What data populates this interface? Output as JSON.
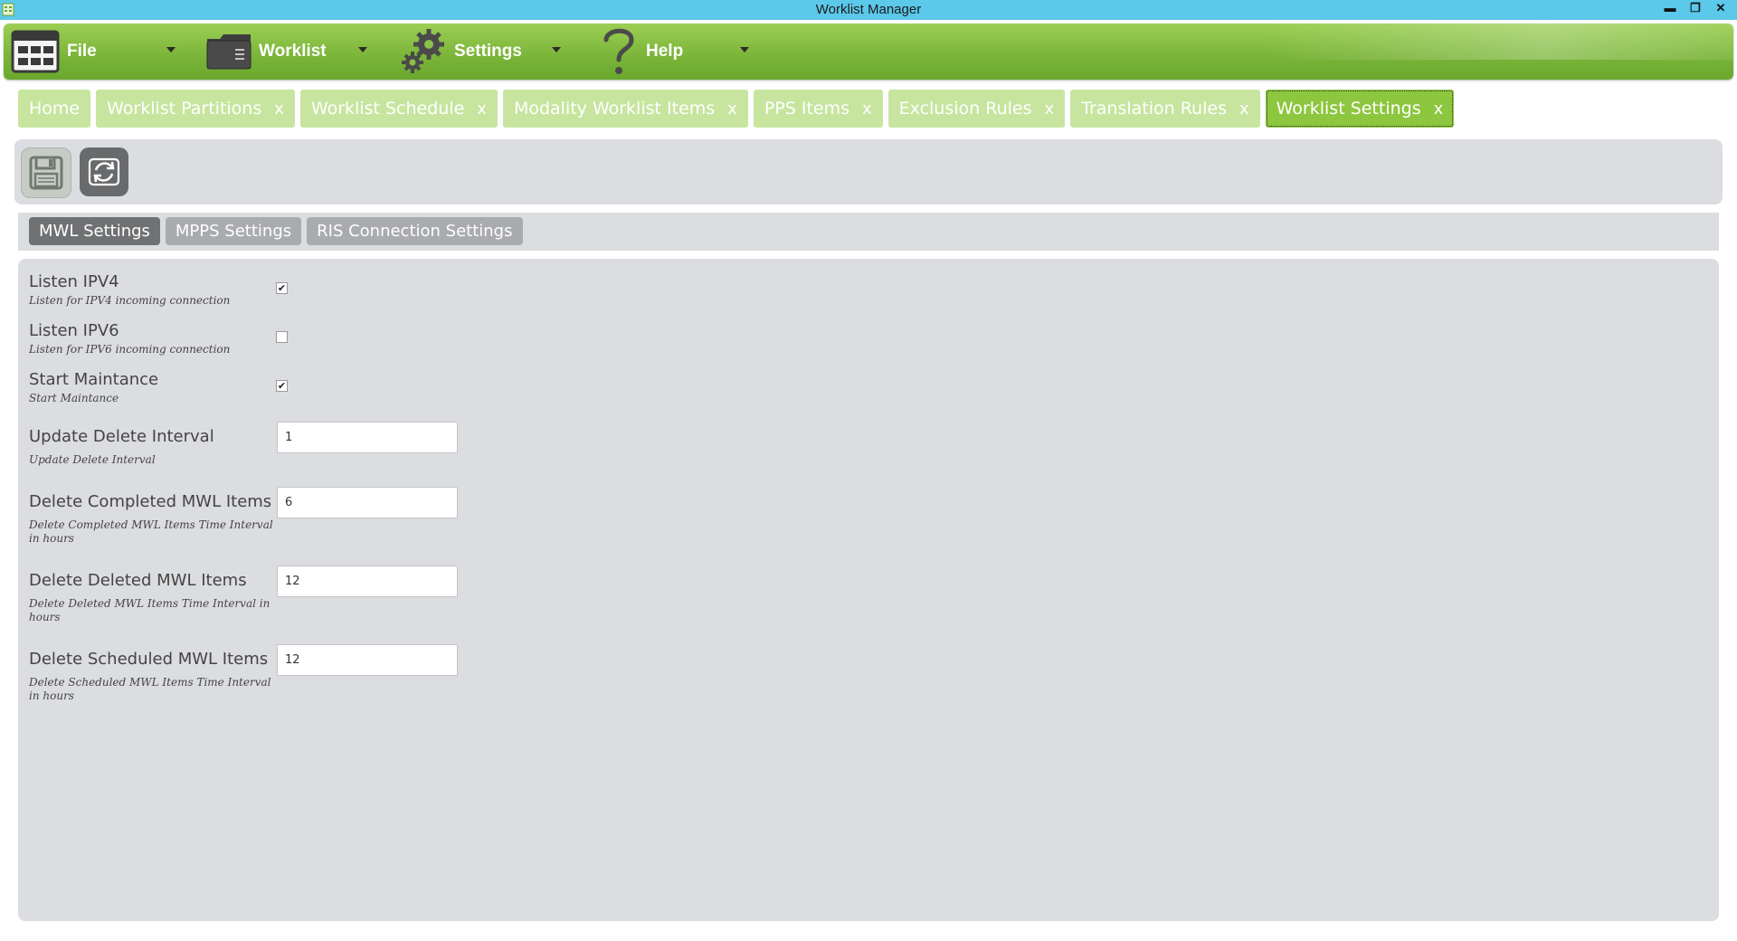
{
  "window": {
    "title": "Worklist Manager",
    "controls": {
      "minimize": "▬",
      "restore": "❐",
      "close": "✕"
    }
  },
  "menu": [
    {
      "label": "File",
      "icon": "file-grid-icon"
    },
    {
      "label": "Worklist",
      "icon": "worklist-folder-icon"
    },
    {
      "label": "Settings",
      "icon": "settings-gears-icon"
    },
    {
      "label": "Help",
      "icon": "help-question-icon"
    }
  ],
  "tabs": [
    {
      "label": "Home",
      "closable": false
    },
    {
      "label": "Worklist Partitions",
      "closable": true
    },
    {
      "label": "Worklist Schedule",
      "closable": true
    },
    {
      "label": "Modality Worklist Items",
      "closable": true
    },
    {
      "label": "PPS Items",
      "closable": true
    },
    {
      "label": "Exclusion Rules",
      "closable": true
    },
    {
      "label": "Translation Rules",
      "closable": true
    },
    {
      "label": "Worklist Settings",
      "closable": true,
      "active": true
    }
  ],
  "tab_close_label": "x",
  "toolbar": {
    "save_icon": "save-icon",
    "refresh_icon": "refresh-icon"
  },
  "subtabs": [
    {
      "label": "MWL Settings",
      "active": true
    },
    {
      "label": "MPPS Settings"
    },
    {
      "label": "RIS Connection Settings"
    }
  ],
  "settings": {
    "listen_ipv4": {
      "label": "Listen IPV4",
      "desc": "Listen for IPV4 incoming connection",
      "checked": true
    },
    "listen_ipv6": {
      "label": "Listen IPV6",
      "desc": "Listen for IPV6 incoming connection",
      "checked": false
    },
    "start_maintance": {
      "label": "Start Maintance",
      "desc": "Start Maintance",
      "checked": true
    },
    "update_delete_interval": {
      "label": "Update Delete Interval",
      "desc": "Update Delete Interval",
      "value": "1"
    },
    "delete_completed": {
      "label": "Delete Completed MWL Items",
      "desc": "Delete Completed MWL Items Time Interval in hours",
      "value": "6"
    },
    "delete_deleted": {
      "label": "Delete Deleted MWL Items",
      "desc": "Delete Deleted MWL Items Time Interval  in hours",
      "value": "12"
    },
    "delete_scheduled": {
      "label": "Delete Scheduled MWL Items",
      "desc": "Delete Scheduled MWL Items Time Interval in hours",
      "value": "12"
    }
  },
  "checkmark": "✔"
}
